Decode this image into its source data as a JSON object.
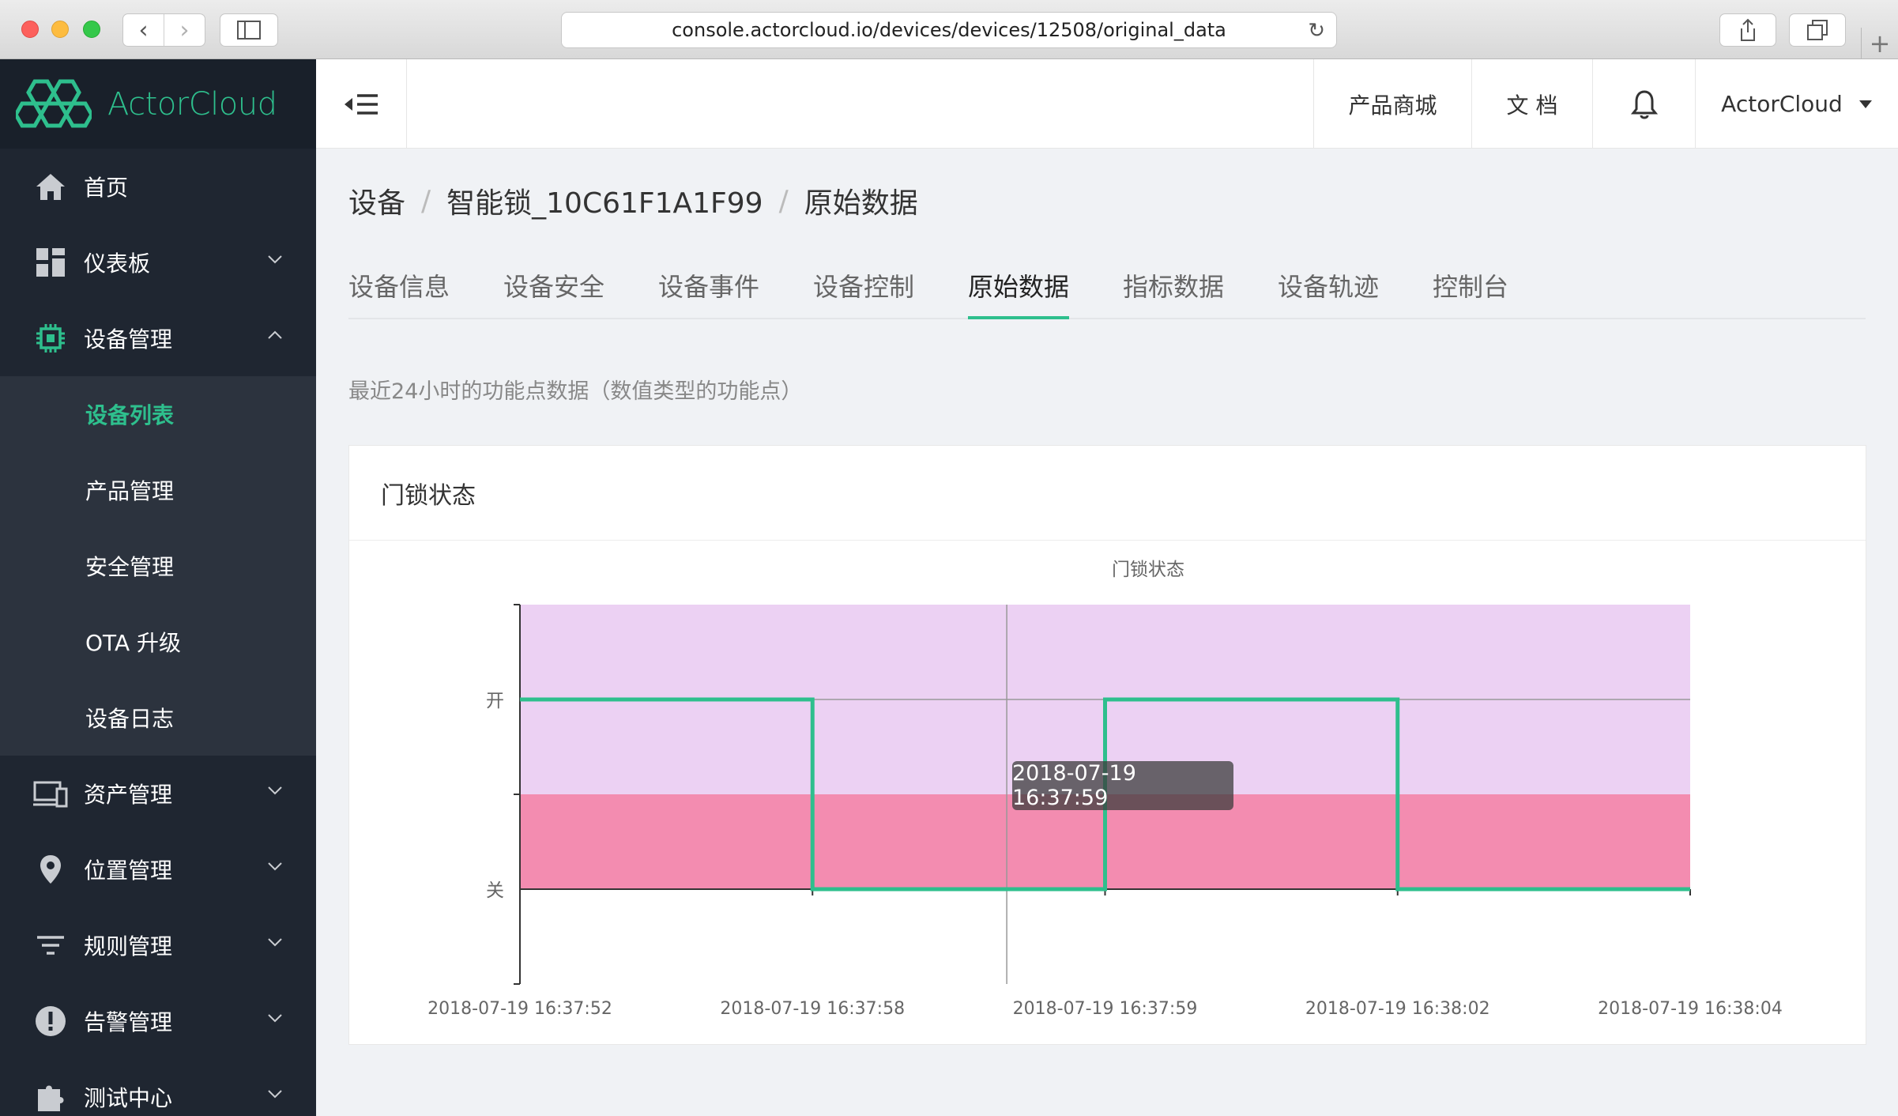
{
  "browser": {
    "url": "console.actorcloud.io/devices/devices/12508/original_data"
  },
  "sidebar": {
    "logo": "ActorCloud",
    "menu": [
      {
        "label": "首页",
        "icon": "home-icon"
      },
      {
        "label": "仪表板",
        "icon": "dashboard-icon"
      },
      {
        "label": "设备管理",
        "icon": "chip-icon"
      },
      {
        "label": "资产管理",
        "icon": "devices-icon"
      },
      {
        "label": "位置管理",
        "icon": "location-pin-icon"
      },
      {
        "label": "规则管理",
        "icon": "filter-icon"
      },
      {
        "label": "告警管理",
        "icon": "alert-icon"
      },
      {
        "label": "测试中心",
        "icon": "puzzle-icon"
      }
    ],
    "submenu": [
      "设备列表",
      "产品管理",
      "安全管理",
      "OTA 升级",
      "设备日志"
    ]
  },
  "header": {
    "store": "产品商城",
    "docs": "文 档",
    "user": "ActorCloud"
  },
  "breadcrumb": [
    "设备",
    "智能锁_10C61F1A1F99",
    "原始数据"
  ],
  "tabs": [
    "设备信息",
    "设备安全",
    "设备事件",
    "设备控制",
    "原始数据",
    "指标数据",
    "设备轨迹",
    "控制台"
  ],
  "subtitle": "最近24小时的功能点数据（数值类型的功能点）",
  "card": {
    "title": "门锁状态"
  },
  "tooltip": "2018-07-19 16:37:59",
  "colors": {
    "accent": "#2ebf8d",
    "sidebar": "#1f2631",
    "band_open": "#ecd1f3",
    "band_closed": "#f38cb0"
  },
  "chart_data": {
    "type": "line",
    "step": true,
    "title": "门锁状态",
    "x_ticks": [
      "2018-07-19 16:37:52",
      "2018-07-19 16:37:58",
      "2018-07-19 16:37:59",
      "2018-07-19 16:38:02",
      "2018-07-19 16:38:04"
    ],
    "y_categories": [
      "关",
      "开"
    ],
    "points": [
      {
        "x": "2018-07-19 16:37:52",
        "y": "开"
      },
      {
        "x": "2018-07-19 16:37:58",
        "y": "关"
      },
      {
        "x": "2018-07-19 16:37:59",
        "y": "开"
      },
      {
        "x": "2018-07-19 16:38:02",
        "y": "关"
      },
      {
        "x": "2018-07-19 16:38:04",
        "y": "关"
      }
    ],
    "series": [
      {
        "values": [
          1,
          0,
          1,
          0,
          0
        ]
      }
    ],
    "grid": false
  }
}
